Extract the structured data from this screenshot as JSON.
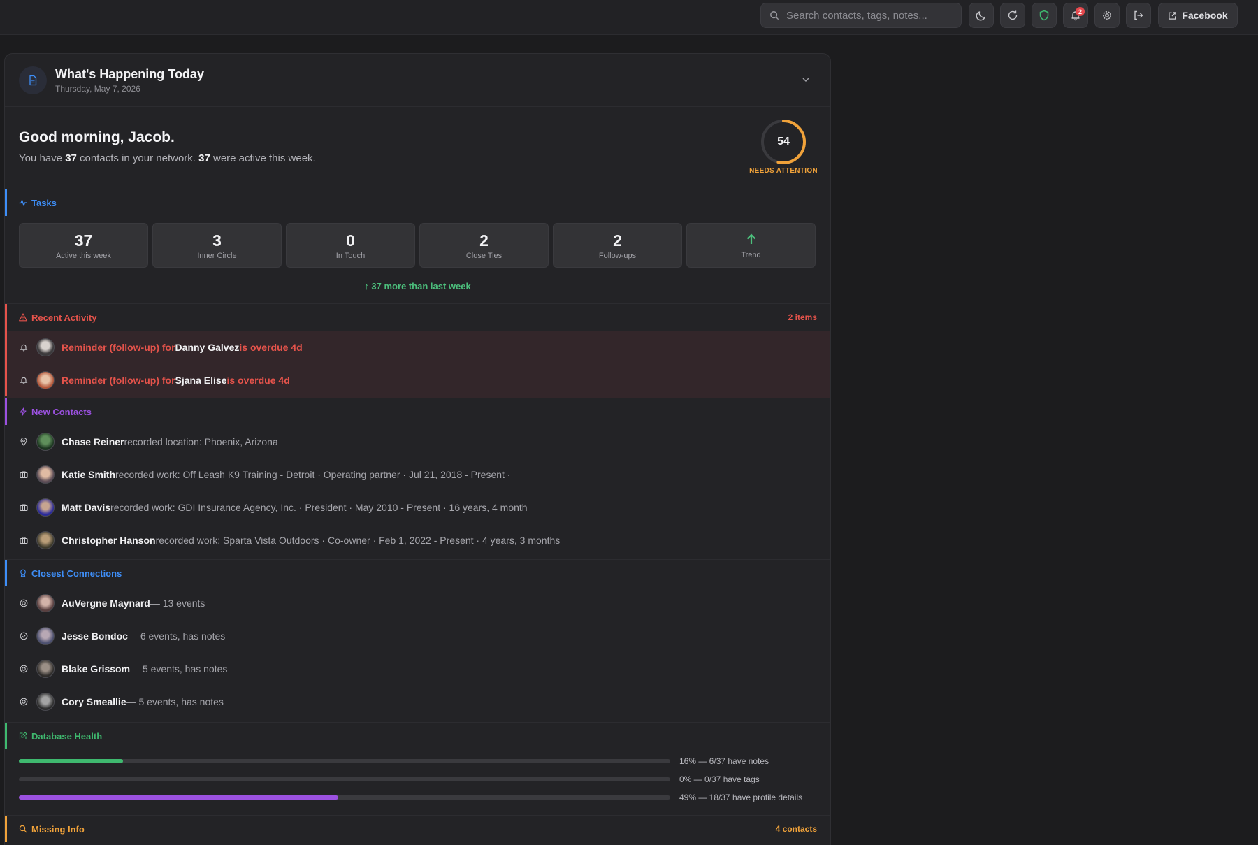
{
  "topbar": {
    "search_placeholder": "Search contacts, tags, notes...",
    "notification_count": "2",
    "facebook_label": "Facebook",
    "icons": [
      "moon-icon",
      "refresh-icon",
      "shield-icon",
      "bell-icon",
      "gear-icon",
      "logout-icon",
      "external-link-icon"
    ]
  },
  "header": {
    "title": "What's Happening Today",
    "date": "Thursday, May 7, 2026"
  },
  "greeting": {
    "title": "Good morning, Jacob.",
    "text_1": "You have ",
    "total_contacts": "37",
    "text_2": " contacts in your network. ",
    "active_contacts": "37",
    "text_3": " were active this week.",
    "score": "54",
    "score_fraction": 0.54,
    "score_label": "NEEDS ATTENTION"
  },
  "tasks": {
    "title": "Tasks",
    "stats": [
      {
        "value": "37",
        "label": "Active this week"
      },
      {
        "value": "3",
        "label": "Inner Circle"
      },
      {
        "value": "0",
        "label": "In Touch"
      },
      {
        "value": "2",
        "label": "Close Ties"
      },
      {
        "value": "2",
        "label": "Follow-ups"
      }
    ],
    "trend_label": "Trend",
    "trend_note": "↑ 37 more than last week"
  },
  "recent_activity": {
    "title": "Recent Activity",
    "count": "2 items",
    "items": [
      {
        "prefix": "Reminder (follow-up) for ",
        "name": "Danny Galvez",
        "suffix": " is overdue 4d"
      },
      {
        "prefix": "Reminder (follow-up) for ",
        "name": "Sjana Elise",
        "suffix": " is overdue 4d"
      }
    ]
  },
  "new_contacts": {
    "title": "New Contacts",
    "items": [
      {
        "name": "Chase Reiner",
        "desc": " recorded location: Phoenix, Arizona"
      },
      {
        "name": "Katie Smith",
        "desc": " recorded work: Off Leash K9 Training - Detroit · Operating partner · Jul 21, 2018 - Present  ·"
      },
      {
        "name": "Matt Davis",
        "desc": " recorded work: GDI Insurance Agency, Inc. · President · May 2010 - Present  · 16 years, 4 month"
      },
      {
        "name": "Christopher Hanson",
        "desc": " recorded work: Sparta Vista Outdoors · Co-owner · Feb 1, 2022 - Present  · 4 years, 3 months"
      }
    ]
  },
  "closest": {
    "title": "Closest Connections",
    "items": [
      {
        "name": "AuVergne Maynard",
        "desc": " — 13 events"
      },
      {
        "name": "Jesse Bondoc",
        "desc": " — 6 events, has notes"
      },
      {
        "name": "Blake Grissom",
        "desc": " — 5 events, has notes"
      },
      {
        "name": "Cory Smeallie",
        "desc": " — 5 events, has notes"
      }
    ]
  },
  "health": {
    "title": "Database Health",
    "rows": [
      {
        "fraction": 0.16,
        "text": "16% — 6/37 have notes",
        "color": "#3fb96f"
      },
      {
        "fraction": 0.0,
        "text": "0% — 0/37 have tags",
        "color": "#3a3a3e"
      },
      {
        "fraction": 0.49,
        "text": "49% — 18/37 have profile details",
        "color": "#9b51e0"
      }
    ]
  },
  "missing": {
    "title": "Missing Info",
    "count": "4 contacts"
  },
  "colors": {
    "tasks": "#3e8ef7",
    "activity": "#e5534b",
    "new_contacts": "#9b51e0",
    "closest": "#3e8ef7",
    "health": "#3fb96f",
    "missing": "#f0a23a",
    "trend_up": "#4cbf7c"
  }
}
